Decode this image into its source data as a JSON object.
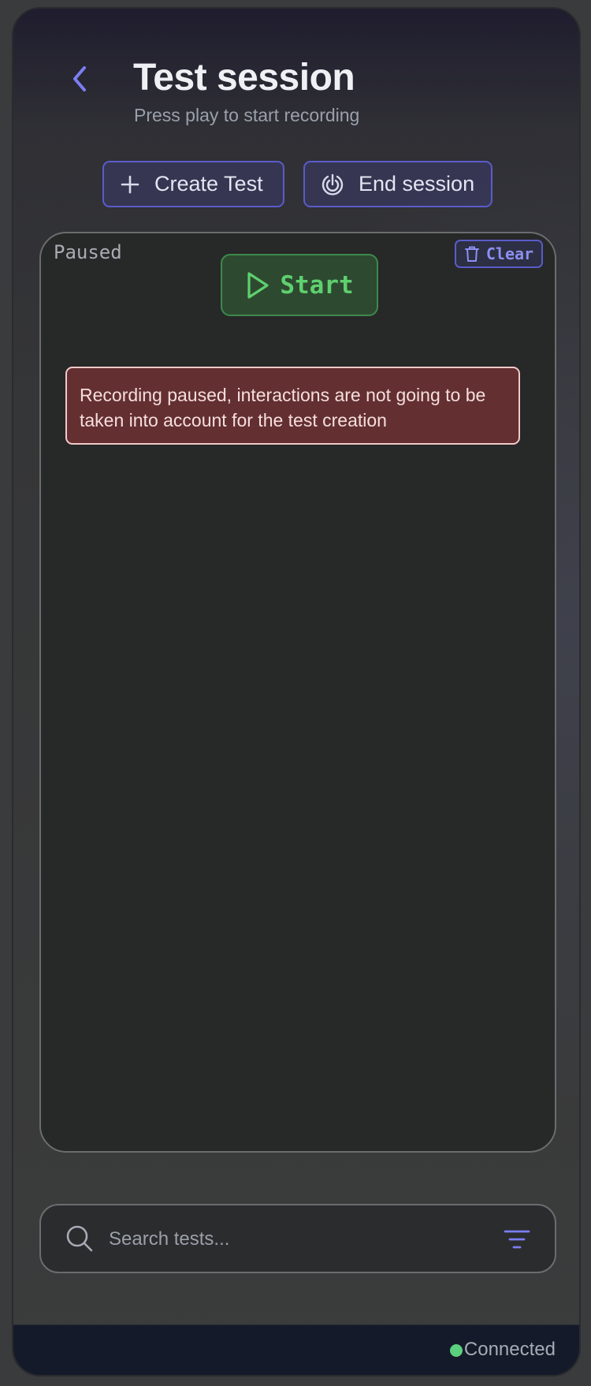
{
  "header": {
    "title": "Test session",
    "subtitle": "Press play to start recording"
  },
  "actions": {
    "create_label": "Create Test",
    "end_label": "End session"
  },
  "recorder": {
    "status": "Paused",
    "clear_label": "Clear",
    "start_label": "Start",
    "warning": "Recording paused, interactions are not going to be taken into account for the test creation"
  },
  "search": {
    "placeholder": "Search tests...",
    "value": ""
  },
  "footer": {
    "connection": "Connected"
  },
  "colors": {
    "accent": "#5a5cc9",
    "success": "#5fd06e",
    "warning_bg": "#632f31",
    "connected": "#5bd07f"
  },
  "icons": [
    "chevron-left-icon",
    "plus-icon",
    "end-session-icon",
    "trash-icon",
    "play-icon",
    "search-icon",
    "filter-icon"
  ]
}
